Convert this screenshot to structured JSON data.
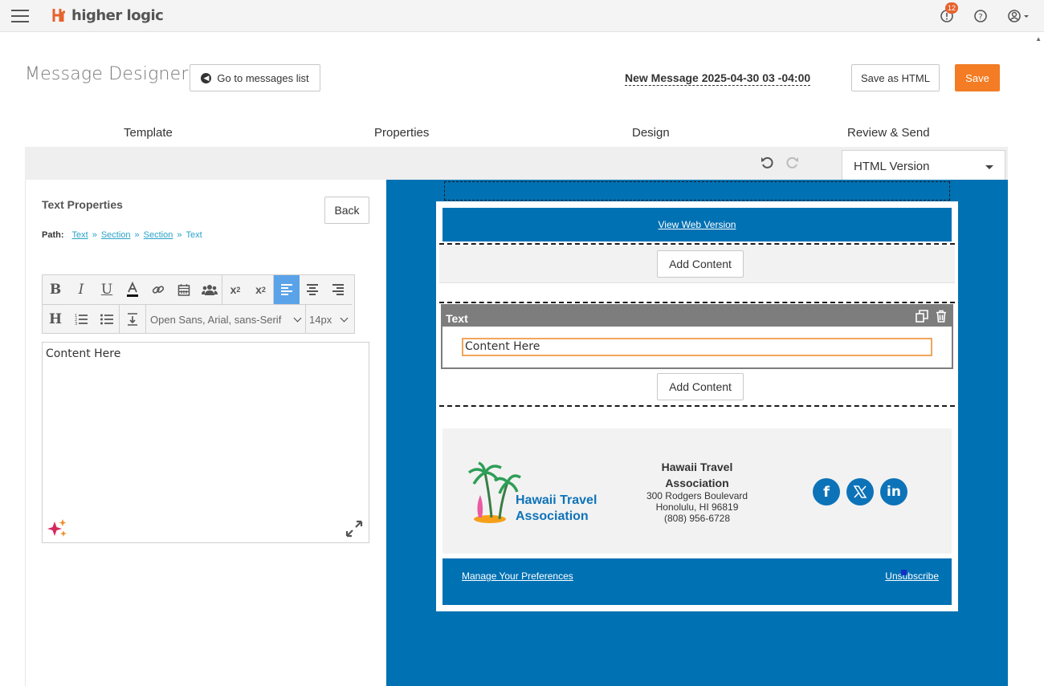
{
  "app": {
    "name": "higher logic",
    "notification_count": "12"
  },
  "header": {
    "title": "Message Designer",
    "goto_label": "Go to messages list",
    "message_name": "New Message 2025-04-30 03 -04:00",
    "save_html_label": "Save as HTML",
    "save_label": "Save"
  },
  "steps": [
    "Template",
    "Properties",
    "Design",
    "Review & Send"
  ],
  "version_select": {
    "selected": "HTML Version"
  },
  "panel": {
    "title": "Text Properties",
    "back_label": "Back",
    "path_label": "Path:",
    "path": [
      "Text",
      "Section",
      "Section",
      "Text"
    ]
  },
  "rte": {
    "font": "Open Sans, Arial, sans-Serif",
    "size": "14px",
    "content": "Content Here",
    "buttons": [
      "bold",
      "italic",
      "underline",
      "font-color",
      "link",
      "calendar",
      "users",
      "superscript",
      "subscript",
      "align-left",
      "align-center",
      "align-right",
      "heading",
      "ordered-list",
      "unordered-list",
      "line-height"
    ]
  },
  "preview": {
    "web_version": "View Web Version",
    "add_content": "Add Content",
    "text_block_label": "Text",
    "content_text": "Content Here",
    "org_name": "Hawaii Travel Association",
    "org_logo_text_1": "Hawaii Travel",
    "org_logo_text_2": "Association",
    "address_1": "300 Rodgers Boulevard",
    "address_2": "Honolulu, HI 96819",
    "phone": "(808) 956-6728",
    "manage_prefs": "Manage Your Preferences",
    "unsubscribe": "Unsubscribe",
    "social": [
      "facebook",
      "x",
      "linkedin"
    ]
  },
  "colors": {
    "accent": "#f37c24",
    "canvas": "#0071b3",
    "link": "#2aa2c8",
    "active_tool": "#5aa3e8"
  }
}
